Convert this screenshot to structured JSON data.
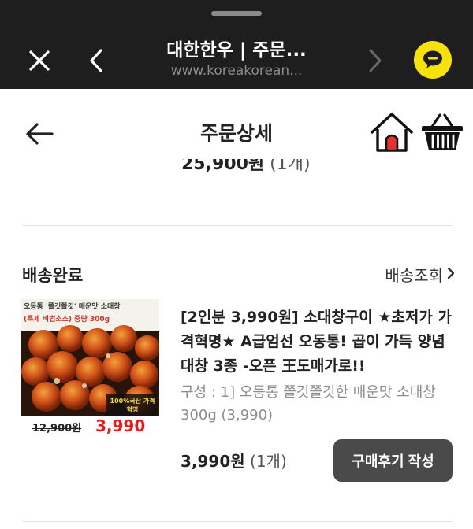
{
  "browser": {
    "title": "대한한우 | 주문...",
    "url": "www.koreakorean..."
  },
  "header": {
    "title": "주문상세"
  },
  "previous_item": {
    "price": "25,900원",
    "qty": "(1개)"
  },
  "order": {
    "status": "배송완료",
    "track_label": "배송조회",
    "thumbnail": {
      "banner": "오동통 '쫄깃쫄깃' 매운맛 소대창",
      "banner2": "(특제 비법소스) 중량 300g",
      "sticker": "100%국산 가격혁명",
      "old_price": "12,900원",
      "new_price": "3,990원"
    },
    "product_name": "[2인분 3,990원] 소대창구이 ★초저가 가격혁명★ A급엄선 오동통! 곱이 가득 양념 대창 3종 -오픈 王도매가로!!",
    "option": "구성 : 1] 오동통 쫄깃쫄깃한 매운맛 소대창 300g (3,990)",
    "price": "3,990원",
    "qty": "(1개)",
    "review_button": "구매후기 작성"
  },
  "colors": {
    "topbar": "#1e1e1e",
    "talk": "#f7e10a",
    "home_roof": "#e5322d",
    "button": "#4a4a4a"
  }
}
